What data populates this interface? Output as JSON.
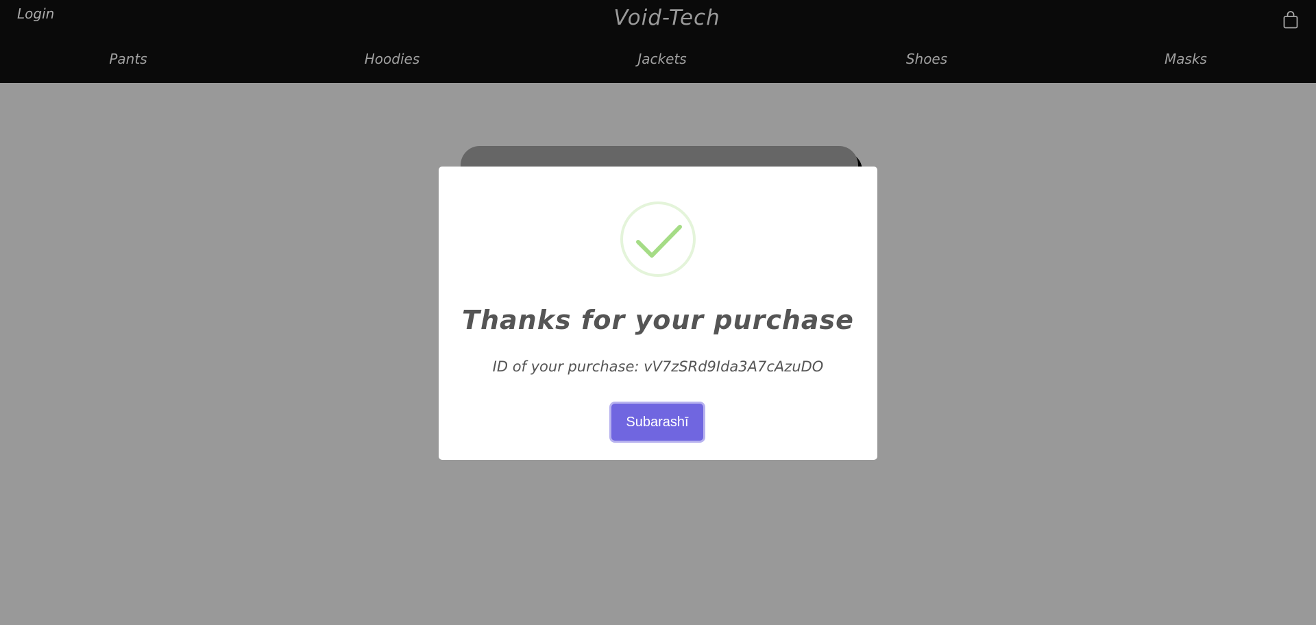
{
  "header": {
    "login_label": "Login",
    "brand": "Void-Tech",
    "cart_icon": "shopping-bag-icon"
  },
  "nav": {
    "items": [
      {
        "label": "Pants"
      },
      {
        "label": "Hoodies"
      },
      {
        "label": "Jackets"
      },
      {
        "label": "Shoes"
      },
      {
        "label": "Masks"
      }
    ]
  },
  "modal": {
    "icon": "success-check-icon",
    "title": "Thanks for your purchase",
    "message": "ID of your purchase: vV7zSRd9Ida3A7cAzuDO",
    "confirm_label": "Subarashī"
  },
  "colors": {
    "page_background": "#999999",
    "header_background": "#0a0a0a",
    "overlay_card": "#666666",
    "button": "#7066e0",
    "check": "#a5dc86"
  }
}
